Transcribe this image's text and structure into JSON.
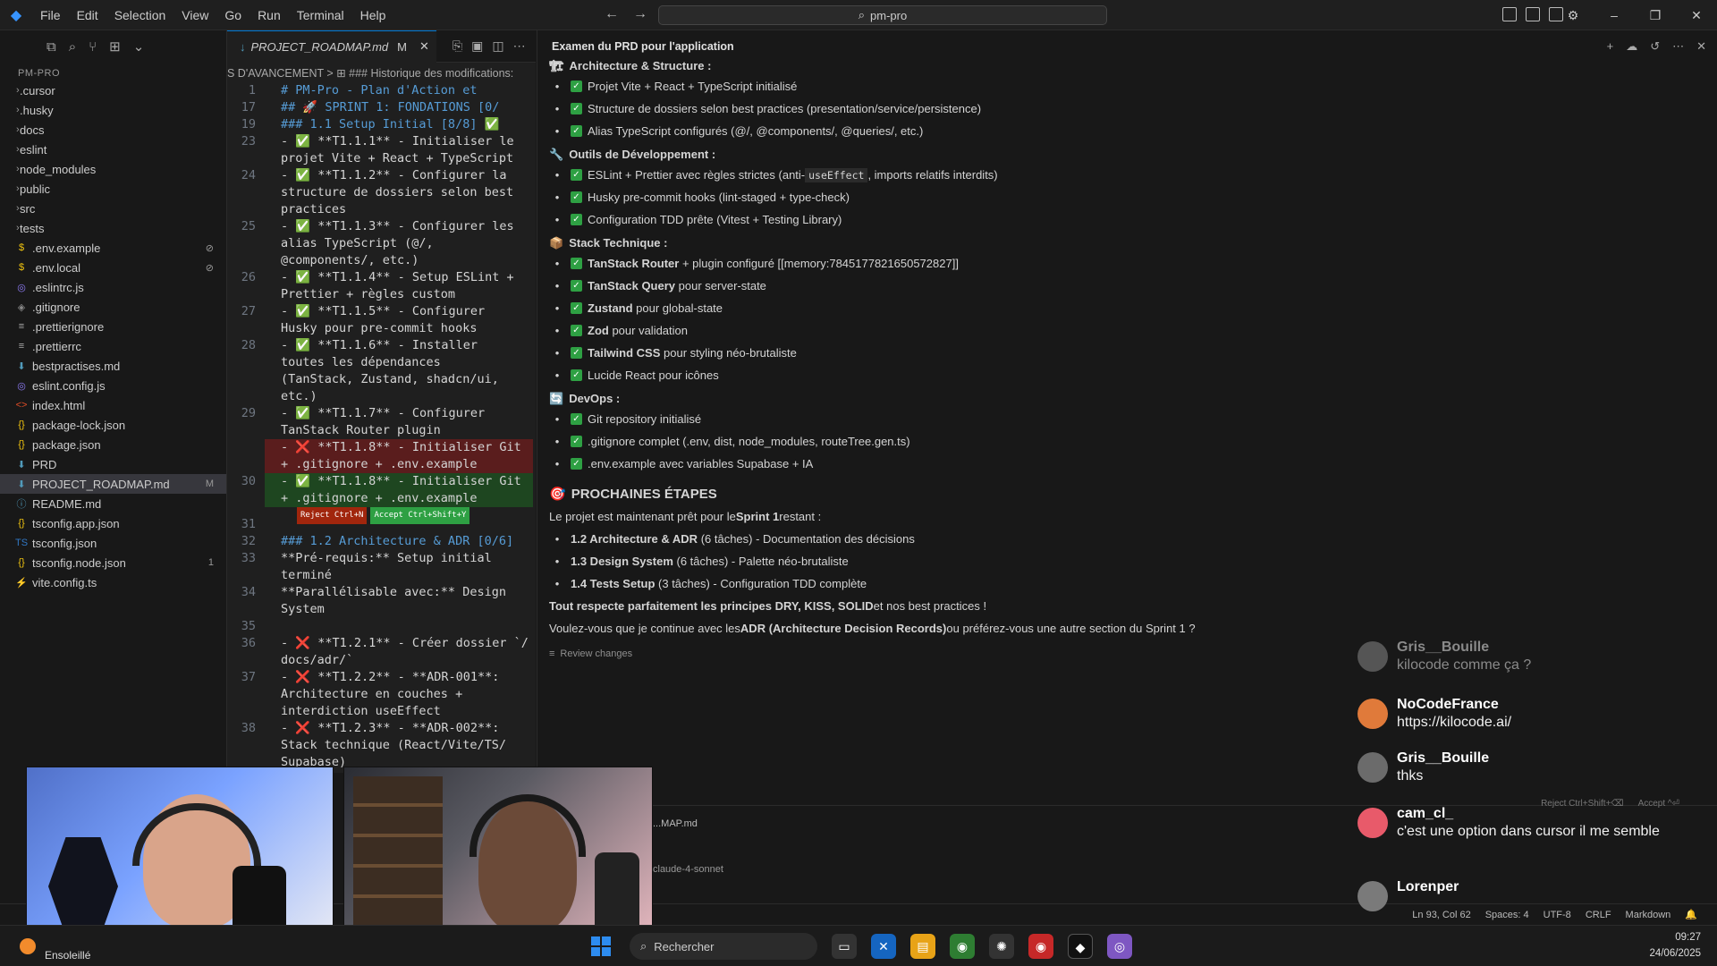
{
  "titlebar": {
    "menu": [
      "File",
      "Edit",
      "Selection",
      "View",
      "Go",
      "Run",
      "Terminal",
      "Help"
    ],
    "search_text": "pm-pro"
  },
  "explorer": {
    "section": "PM-PRO",
    "items": [
      {
        "name": ".cursor",
        "type": "folder",
        "badge": ""
      },
      {
        "name": ".husky",
        "type": "folder",
        "badge": ""
      },
      {
        "name": "docs",
        "type": "folder",
        "badge": ""
      },
      {
        "name": "eslint",
        "type": "folder",
        "badge": ""
      },
      {
        "name": "node_modules",
        "type": "folder",
        "badge": ""
      },
      {
        "name": "public",
        "type": "folder",
        "badge": ""
      },
      {
        "name": "src",
        "type": "folder",
        "badge": ""
      },
      {
        "name": "tests",
        "type": "folder",
        "badge": ""
      },
      {
        "name": ".env.example",
        "type": "env",
        "badge": "⊘"
      },
      {
        "name": ".env.local",
        "type": "env",
        "badge": "⊘"
      },
      {
        "name": ".eslintrc.js",
        "type": "eslint",
        "badge": ""
      },
      {
        "name": ".gitignore",
        "type": "git",
        "badge": ""
      },
      {
        "name": ".prettierignore",
        "type": "lines",
        "badge": ""
      },
      {
        "name": ".prettierrc",
        "type": "lines",
        "badge": ""
      },
      {
        "name": "bestpractises.md",
        "type": "md",
        "badge": ""
      },
      {
        "name": "eslint.config.js",
        "type": "eslint",
        "badge": ""
      },
      {
        "name": "index.html",
        "type": "html",
        "badge": ""
      },
      {
        "name": "package-lock.json",
        "type": "json",
        "badge": ""
      },
      {
        "name": "package.json",
        "type": "json",
        "badge": ""
      },
      {
        "name": "PRD",
        "type": "md",
        "badge": ""
      },
      {
        "name": "PROJECT_ROADMAP.md",
        "type": "md",
        "badge": "M"
      },
      {
        "name": "README.md",
        "type": "info",
        "badge": ""
      },
      {
        "name": "tsconfig.app.json",
        "type": "json",
        "badge": ""
      },
      {
        "name": "tsconfig.json",
        "type": "ts",
        "badge": ""
      },
      {
        "name": "tsconfig.node.json",
        "type": "json",
        "badge": "1"
      },
      {
        "name": "vite.config.ts",
        "type": "vite",
        "badge": ""
      }
    ]
  },
  "editor": {
    "tab_label": "PROJECT_ROADMAP.md",
    "tab_modified": "M",
    "breadcrumb": "S D'AVANCEMENT > ⊞ ### Historique des modifications:",
    "reject_label": "Reject Ctrl+N",
    "accept_label": "Accept Ctrl+Shift+Y",
    "lines": [
      {
        "n": "1",
        "t": "# PM-Pro - Plan d'Action et",
        "k": ""
      },
      {
        "n": "17",
        "t": "## 🚀 SPRINT 1: FONDATIONS [0/",
        "k": ""
      },
      {
        "n": "19",
        "t": "### 1.1 Setup Initial [8/8] ✅",
        "k": ""
      },
      {
        "n": "23",
        "t": "- ✅ **T1.1.1** - Initialiser le",
        "k": ""
      },
      {
        "n": "",
        "t": "projet Vite + React + TypeScript",
        "k": ""
      },
      {
        "n": "24",
        "t": "- ✅ **T1.1.2** - Configurer la",
        "k": ""
      },
      {
        "n": "",
        "t": "structure de dossiers selon best",
        "k": ""
      },
      {
        "n": "",
        "t": "practices",
        "k": ""
      },
      {
        "n": "25",
        "t": "- ✅ **T1.1.3** - Configurer les",
        "k": ""
      },
      {
        "n": "",
        "t": "alias TypeScript (@/,",
        "k": ""
      },
      {
        "n": "",
        "t": "@components/, etc.)",
        "k": ""
      },
      {
        "n": "26",
        "t": "- ✅ **T1.1.4** - Setup ESLint +",
        "k": ""
      },
      {
        "n": "",
        "t": "Prettier + règles custom",
        "k": ""
      },
      {
        "n": "27",
        "t": "- ✅ **T1.1.5** - Configurer",
        "k": ""
      },
      {
        "n": "",
        "t": "Husky pour pre-commit hooks",
        "k": ""
      },
      {
        "n": "28",
        "t": "- ✅ **T1.1.6** - Installer",
        "k": ""
      },
      {
        "n": "",
        "t": "toutes les dépendances",
        "k": ""
      },
      {
        "n": "",
        "t": "(TanStack, Zustand, shadcn/ui,",
        "k": ""
      },
      {
        "n": "",
        "t": "etc.)",
        "k": ""
      },
      {
        "n": "29",
        "t": "- ✅ **T1.1.7** - Configurer",
        "k": ""
      },
      {
        "n": "",
        "t": "TanStack Router plugin",
        "k": ""
      },
      {
        "n": "",
        "t": "- ❌ **T1.1.8** - Initialiser Git",
        "k": "del"
      },
      {
        "n": "",
        "t": "+ .gitignore + .env.example",
        "k": "del"
      },
      {
        "n": "30",
        "t": "- ✅ **T1.1.8** - Initialiser Git",
        "k": "add"
      },
      {
        "n": "",
        "t": "+ .gitignore + .env.example",
        "k": "add"
      },
      {
        "n": "",
        "t": "",
        "k": "actions"
      },
      {
        "n": "31",
        "t": "",
        "k": ""
      },
      {
        "n": "32",
        "t": "### 1.2 Architecture & ADR [0/6]",
        "k": ""
      },
      {
        "n": "33",
        "t": "**Pré-requis:** Setup initial",
        "k": ""
      },
      {
        "n": "",
        "t": "terminé",
        "k": ""
      },
      {
        "n": "34",
        "t": "**Parallélisable avec:** Design",
        "k": ""
      },
      {
        "n": "",
        "t": "System",
        "k": ""
      },
      {
        "n": "35",
        "t": "",
        "k": ""
      },
      {
        "n": "36",
        "t": "- ❌ **T1.2.1** - Créer dossier `/",
        "k": ""
      },
      {
        "n": "",
        "t": "docs/adr/`",
        "k": ""
      },
      {
        "n": "37",
        "t": "- ❌ **T1.2.2** - **ADR-001**:",
        "k": ""
      },
      {
        "n": "",
        "t": "Architecture en couches +",
        "k": ""
      },
      {
        "n": "",
        "t": "interdiction useEffect",
        "k": ""
      },
      {
        "n": "38",
        "t": "- ❌ **T1.2.3** - **ADR-002**:",
        "k": ""
      },
      {
        "n": "",
        "t": "Stack technique (React/Vite/TS/",
        "k": ""
      },
      {
        "n": "",
        "t": "Supabase)",
        "k": ""
      }
    ]
  },
  "chat": {
    "title": "Examen du PRD pour l'application",
    "sec1": "Architecture & Structure :",
    "s1": [
      "Projet Vite + React + TypeScript initialisé",
      "Structure de dossiers selon best practices (presentation/service/persistence)",
      "Alias TypeScript configurés (@/, @components/, @queries/, etc.)"
    ],
    "sec2": "Outils de Développement :",
    "s2_a_pre": "ESLint + Prettier avec règles strictes (anti-",
    "s2_a_code": "useEffect",
    "s2_a_post": ", imports relatifs interdits)",
    "s2": [
      "Husky pre-commit hooks (lint-staged + type-check)",
      "Configuration TDD prête (Vitest + Testing Library)"
    ],
    "sec3": "Stack Technique :",
    "s3": [
      {
        "b": "TanStack Router",
        "r": " + plugin configuré [[memory:7845177821650572827]]"
      },
      {
        "b": "TanStack Query",
        "r": " pour server-state"
      },
      {
        "b": "Zustand",
        "r": " pour global-state"
      },
      {
        "b": "Zod",
        "r": " pour validation"
      },
      {
        "b": "Tailwind CSS",
        "r": " pour styling néo-brutaliste"
      },
      {
        "b": "",
        "r": "Lucide React pour icônes"
      }
    ],
    "sec4": "DevOps :",
    "s4": [
      "Git repository initialisé",
      ".gitignore complet (.env, dist, node_modules, routeTree.gen.ts)",
      ".env.example avec variables Supabase + IA"
    ],
    "next_title": "PROCHAINES ÉTAPES",
    "next_intro_pre": "Le projet est maintenant prêt pour le ",
    "next_intro_b": "Sprint 1",
    "next_intro_post": " restant :",
    "next_items": [
      {
        "b": "1.2 Architecture & ADR",
        "r": " (6 tâches) - Documentation des décisions"
      },
      {
        "b": "1.3 Design System",
        "r": " (6 tâches) - Palette néo-brutaliste"
      },
      {
        "b": "1.4 Tests Setup",
        "r": " (3 tâches) - Configuration TDD complète"
      }
    ],
    "closing_b": "Tout respecte parfaitement les principes DRY, KISS, SOLID",
    "closing_r": " et nos best practices !",
    "question_pre": "Voulez-vous que je continue avec les ",
    "question_b": "ADR (Architecture Decision Records)",
    "question_post": " ou préférez-vous une autre section du Sprint 1 ?",
    "review": "Review changes",
    "input_file": "...MAP.md",
    "model": "claude-4-sonnet",
    "reject_all": "Reject Ctrl+Shift+⌫",
    "accept_all": "Accept ^⏎"
  },
  "statusbar": {
    "position": "Ln 93, Col 62",
    "spaces": "Spaces: 4",
    "encoding": "UTF-8",
    "eol": "CRLF",
    "language": "Markdown"
  },
  "twitch_chat": [
    {
      "user": "Gris__Bouille",
      "text": "kilocode comme ça ?",
      "faded": true,
      "color": "#555555"
    },
    {
      "user": "NoCodeFrance",
      "text": "https://kilocode.ai/",
      "faded": false,
      "color": "#e07a3a"
    },
    {
      "user": "Gris__Bouille",
      "text": "thks",
      "faded": false,
      "color": "#6b6b6b"
    },
    {
      "user": "cam_cl_",
      "text": "c'est une option dans cursor il me semble",
      "faded": false,
      "color": "#e85a6a"
    },
    {
      "user": "Lorenper",
      "text": "",
      "faded": false,
      "color": "#7a7a7a"
    }
  ],
  "taskbar": {
    "weather": "Ensoleillé",
    "search": "Rechercher",
    "time": "09:27",
    "date": "24/06/2025"
  }
}
